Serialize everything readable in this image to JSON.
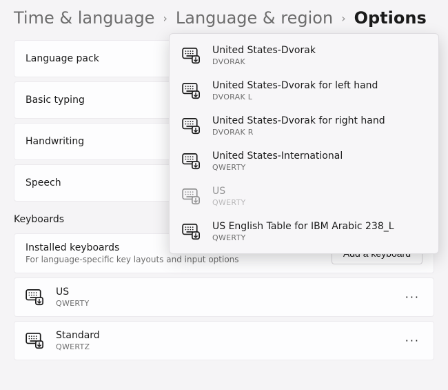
{
  "breadcrumb": {
    "level1": "Time & language",
    "level2": "Language & region",
    "level3": "Options"
  },
  "features": {
    "language_pack": "Language pack",
    "basic_typing": "Basic typing",
    "handwriting": "Handwriting",
    "speech": "Speech"
  },
  "keyboards_section": {
    "header": "Keyboards",
    "installed_title": "Installed keyboards",
    "installed_subtitle": "For language-specific key layouts and input options",
    "add_button": "Add a keyboard"
  },
  "installed": [
    {
      "name": "US",
      "layout": "QWERTY"
    },
    {
      "name": "Standard",
      "layout": "QWERTZ"
    }
  ],
  "flyout": [
    {
      "name": "United States-Dvorak",
      "layout": "DVORAK",
      "disabled": false
    },
    {
      "name": "United States-Dvorak for left hand",
      "layout": "DVORAK L",
      "disabled": false
    },
    {
      "name": "United States-Dvorak for right hand",
      "layout": "DVORAK R",
      "disabled": false
    },
    {
      "name": "United States-International",
      "layout": "QWERTY",
      "disabled": false
    },
    {
      "name": "US",
      "layout": "QWERTY",
      "disabled": true
    },
    {
      "name": "US English Table for IBM Arabic 238_L",
      "layout": "QWERTY",
      "disabled": false
    }
  ],
  "icons": {
    "more": "···"
  }
}
